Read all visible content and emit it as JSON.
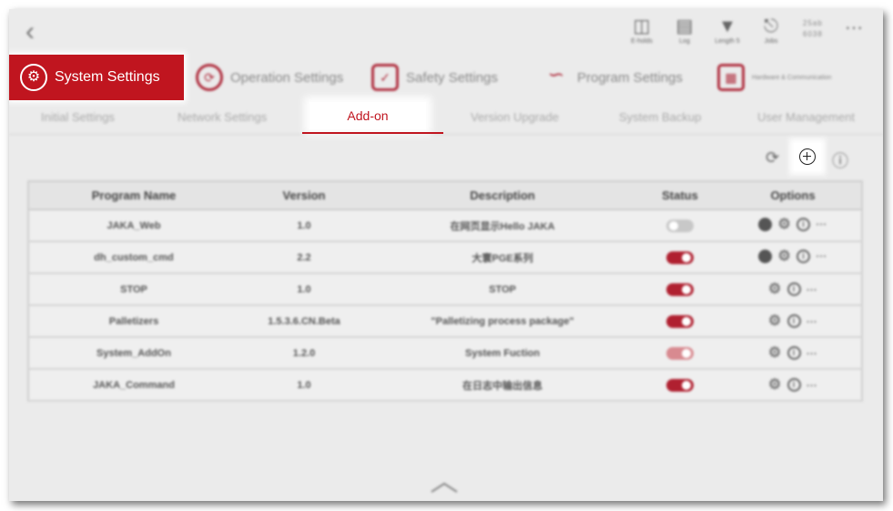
{
  "status_bar": {
    "items": [
      {
        "icon": "robot-status-icon",
        "label": "E-holds"
      },
      {
        "icon": "log-icon",
        "label": "Log"
      },
      {
        "icon": "wifi-icon",
        "label": "Length 5"
      },
      {
        "icon": "jobs-icon",
        "label": "Jobs"
      }
    ],
    "clock_line1": "25ab",
    "clock_line2": "6038"
  },
  "main_nav": {
    "system": "System Settings",
    "operation": "Operation Settings",
    "safety": "Safety Settings",
    "program": "Program Settings",
    "hardware": "Hardware & Communication"
  },
  "sub_nav": {
    "initial": "Initial Settings",
    "network": "Network Settings",
    "addon": "Add-on",
    "version": "Version Upgrade",
    "backup": "System Backup",
    "user": "User Management"
  },
  "table": {
    "headers": [
      "Program Name",
      "Version",
      "Description",
      "Status",
      "Options"
    ],
    "rows": [
      {
        "name": "JAKA_Web",
        "version": "1.0",
        "description": "在网页显示Hello JAKA",
        "status": "off"
      },
      {
        "name": "dh_custom_cmd",
        "version": "2.2",
        "description": "大寰PGE系列",
        "status": "on"
      },
      {
        "name": "STOP",
        "version": "1.0",
        "description": "STOP",
        "status": "on"
      },
      {
        "name": "Palletizers",
        "version": "1.5.3.6.CN.Beta",
        "description": "\"Palletizing process package\"",
        "status": "on"
      },
      {
        "name": "System_AddOn",
        "version": "1.2.0",
        "description": "System Fuction",
        "status": "faded"
      },
      {
        "name": "JAKA_Command",
        "version": "1.0",
        "description": "在日志中输出信息",
        "status": "on"
      }
    ]
  },
  "colors": {
    "accent": "#c0151f"
  }
}
